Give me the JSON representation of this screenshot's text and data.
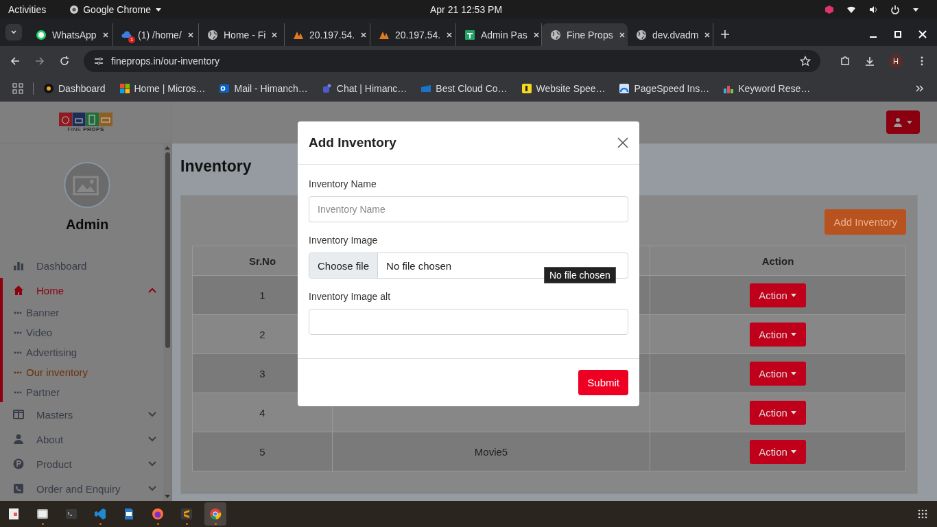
{
  "top_bar": {
    "activities": "Activities",
    "app_name": "Google Chrome",
    "clock": "Apr 21  12:53 PM"
  },
  "browser_tabs": [
    {
      "title": "WhatsApp",
      "selected": false
    },
    {
      "title": "(1) /home/",
      "badge": "1",
      "selected": false
    },
    {
      "title": "Home - Fi",
      "selected": false
    },
    {
      "title": "20.197.54.",
      "selected": false
    },
    {
      "title": "20.197.54.",
      "selected": false
    },
    {
      "title": "Admin Pas",
      "selected": false
    },
    {
      "title": "Fine Props",
      "selected": true
    },
    {
      "title": "dev.dvadm",
      "selected": false
    }
  ],
  "address": "fineprops.in/our-inventory",
  "profile_letter": "H",
  "bookmarks": [
    {
      "title": "Dashboard"
    },
    {
      "title": "Home | Micros…"
    },
    {
      "title": "Mail - Himanch…"
    },
    {
      "title": "Chat | Himanc…"
    },
    {
      "title": "Best Cloud Co…"
    },
    {
      "title": "Website Spee…"
    },
    {
      "title": "PageSpeed Ins…"
    },
    {
      "title": "Keyword Rese…"
    }
  ],
  "sidebar": {
    "logo_name": "FINE **PROPS**",
    "user_name": "Admin",
    "items": [
      {
        "label": "Dashboard",
        "selected": false
      },
      {
        "label": "Home",
        "selected": true,
        "expanded": true,
        "children": [
          {
            "label": "Banner",
            "selected": false
          },
          {
            "label": "Video",
            "selected": false
          },
          {
            "label": "Advertising",
            "selected": false
          },
          {
            "label": "Our inventory",
            "selected": true
          },
          {
            "label": "Partner",
            "selected": false
          }
        ]
      },
      {
        "label": "Masters",
        "selected": false,
        "expanded": false
      },
      {
        "label": "About",
        "selected": false,
        "expanded": false
      },
      {
        "label": "Product",
        "selected": false,
        "expanded": false
      },
      {
        "label": "Order and Enquiry",
        "selected": false,
        "expanded": false
      }
    ]
  },
  "page_title": "Inventory",
  "add_button": "Add Inventory",
  "table": {
    "columns": [
      {
        "label": "Sr.No"
      },
      {
        "label": "Action"
      }
    ],
    "rows": [
      {
        "sr": "1",
        "action": "Action"
      },
      {
        "sr": "2",
        "action": "Action"
      },
      {
        "sr": "3",
        "action": "Action"
      },
      {
        "sr": "4",
        "action": "Action"
      },
      {
        "sr": "5",
        "name": "Movie5",
        "action": "Action"
      }
    ]
  },
  "modal": {
    "title": "Add Inventory",
    "fields": [
      {
        "kind": "text",
        "label": "Inventory Name",
        "placeholder": "Inventory Name"
      },
      {
        "kind": "file",
        "label": "Inventory Image",
        "button": "Choose file",
        "value": "No file chosen"
      },
      {
        "kind": "text",
        "label": "Inventory Image alt"
      }
    ],
    "tooltip": "No file chosen",
    "submit": "Submit"
  },
  "taskbar": [
    {
      "running": false,
      "selected": false
    },
    {
      "running": true,
      "selected": false
    },
    {
      "running": false,
      "selected": false
    },
    {
      "running": true,
      "selected": false
    },
    {
      "running": false,
      "selected": false
    },
    {
      "running": true,
      "selected": false
    },
    {
      "running": true,
      "selected": false
    },
    {
      "running": true,
      "selected": true
    }
  ]
}
